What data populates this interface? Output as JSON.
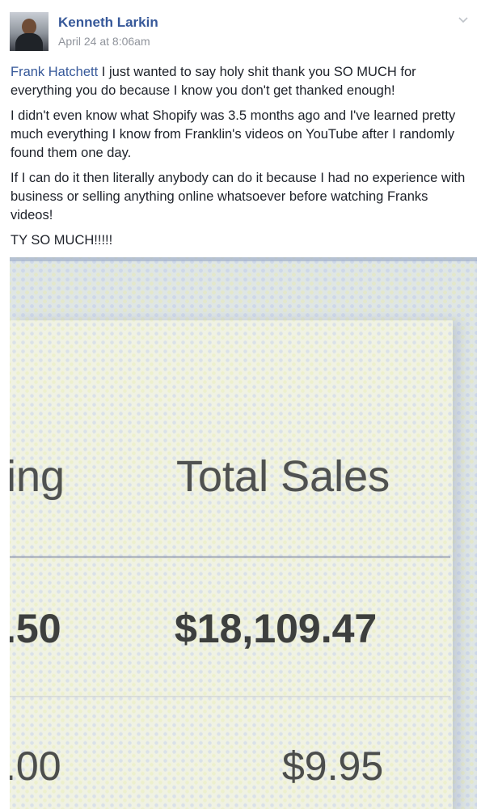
{
  "post": {
    "author": "Kenneth Larkin",
    "timestamp": "April 24 at 8:06am",
    "mention": "Frank Hatchett",
    "paragraphs": [
      " I just wanted to say holy shit thank you SO MUCH for everything you do because I know you don't get thanked enough!",
      "I didn't even know what Shopify was 3.5 months ago and I've learned pretty much everything I know from Franklin's videos on YouTube after I randomly found them one day.",
      "If I can do it then literally anybody can do it because I had no experience with business or selling anything online whatsoever before watching Franks videos!",
      "TY SO MUCH!!!!!"
    ],
    "icons": {
      "avatar": "profile-photo",
      "options": "chevron-down-icon"
    },
    "colors": {
      "link": "#365899",
      "meta": "#90949c",
      "body_text": "#1d2129"
    }
  },
  "photo": {
    "column_header_left": "ing",
    "column_header_right": "Total Sales",
    "row1_left": ".50",
    "row1_right": "$18,109.47",
    "row2_left": ".00",
    "row2_right": "$9.95"
  }
}
